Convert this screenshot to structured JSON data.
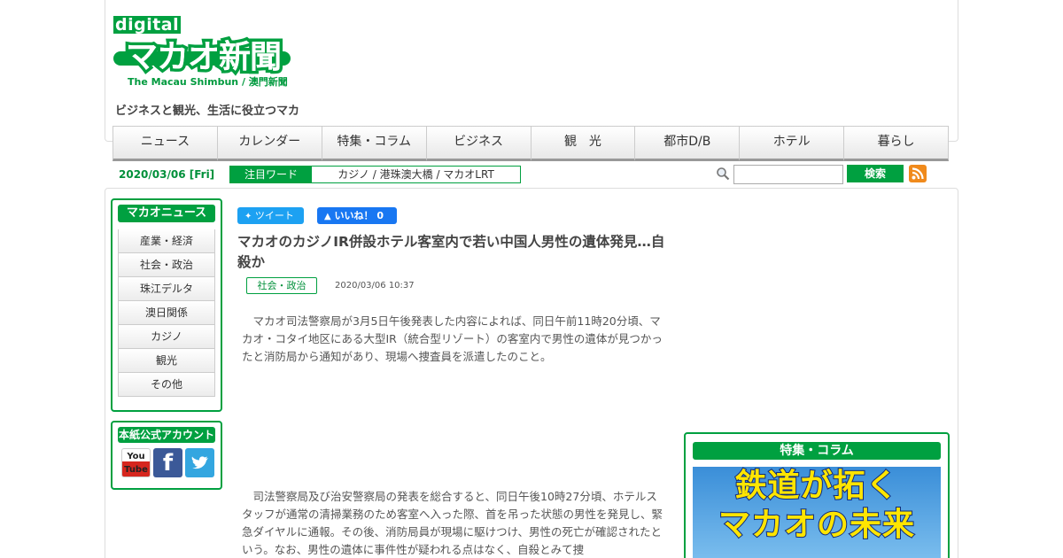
{
  "header": {
    "logo_top": "digital",
    "logo_main": "マカオ新聞",
    "logo_sub": "The Macau Shimbun / 澳門新聞",
    "tagline": "ビジネスと観光、生活に役立つマカ"
  },
  "nav": {
    "items": [
      "ニュース",
      "カレンダー",
      "特集・コラム",
      "ビジネス",
      "観　光",
      "都市D/B",
      "ホテル",
      "暮らし"
    ]
  },
  "subbar": {
    "date": "2020/03/06 [Fri]",
    "keywords_label": "注目ワード",
    "keywords": "カジノ / 港珠澳大橋 / マカオLRT",
    "search_button": "検索",
    "search_value": ""
  },
  "sidebar": {
    "title": "マカオニュース",
    "items": [
      "産業・経済",
      "社会・政治",
      "珠江デルタ",
      "澳日関係",
      "カジノ",
      "観光",
      "その他"
    ],
    "accounts_title": "本紙公式アカウント",
    "youtube_label": "You Tube",
    "facebook_label": "f"
  },
  "article": {
    "tweet": "ツイート",
    "like": "いいね！ 0",
    "headline": "マカオのカジノIR併設ホテル客室内で若い中国人男性の遺体発見…自殺か",
    "category": "社会・政治",
    "date": "2020/03/06 10:37",
    "para1": "　マカオ司法警察局が3月5日午後発表した内容によれば、同日午前11時20分頃、マカオ・コタイ地区にある大型IR（統合型リゾート）の客室内で男性の遺体が見つかったと消防局から通知があり、現場へ捜査員を派遣したのこと。",
    "para2": "　司法警察局及び治安警察局の発表を総合すると、同日午後10時27分頃、ホテルスタッフが通常の清掃業務のため客室へ入った際、首を吊った状態の男性を発見し、緊急ダイヤルに通報。その後、消防局員が現場に駆けつけ、男性の死亡が確認されたという。なお、男性の遺体に事件性が疑われる点はなく、自殺とみて捜"
  },
  "right": {
    "title": "特集・コラム",
    "banner_line1": "鉄道が拓く",
    "banner_line2": "マカオの未来"
  },
  "colors": {
    "brand_green": "#00a040",
    "twitter_blue": "#1da1f2",
    "facebook_blue": "#1877f2"
  }
}
